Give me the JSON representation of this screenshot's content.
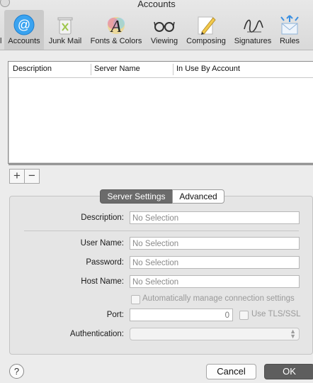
{
  "window": {
    "title": "Accounts"
  },
  "toolbar": {
    "left_stub": "l",
    "items": [
      {
        "label": "Accounts",
        "icon": "at-sign-icon",
        "active": true
      },
      {
        "label": "Junk Mail",
        "icon": "trash-icon"
      },
      {
        "label": "Fonts & Colors",
        "icon": "font-a-icon"
      },
      {
        "label": "Viewing",
        "icon": "glasses-icon"
      },
      {
        "label": "Composing",
        "icon": "pencil-icon"
      },
      {
        "label": "Signatures",
        "icon": "signature-icon"
      },
      {
        "label": "Rules",
        "icon": "rules-envelope-icon"
      }
    ]
  },
  "accounts_table": {
    "columns": [
      "Description",
      "Server Name",
      "In Use By Account"
    ],
    "rows": []
  },
  "list_controls": {
    "add": "+",
    "remove": "−"
  },
  "segments": {
    "server_settings": "Server Settings",
    "advanced": "Advanced",
    "selected": "Server Settings"
  },
  "form": {
    "description_label": "Description:",
    "description_value": "No Selection",
    "username_label": "User Name:",
    "username_value": "No Selection",
    "password_label": "Password:",
    "password_value": "No Selection",
    "hostname_label": "Host Name:",
    "hostname_value": "No Selection",
    "auto_manage_label": "Automatically manage connection settings",
    "port_label": "Port:",
    "port_value": "0",
    "tls_label": "Use TLS/SSL",
    "auth_label": "Authentication:",
    "auth_value": ""
  },
  "footer": {
    "help": "?",
    "cancel": "Cancel",
    "ok": "OK"
  }
}
